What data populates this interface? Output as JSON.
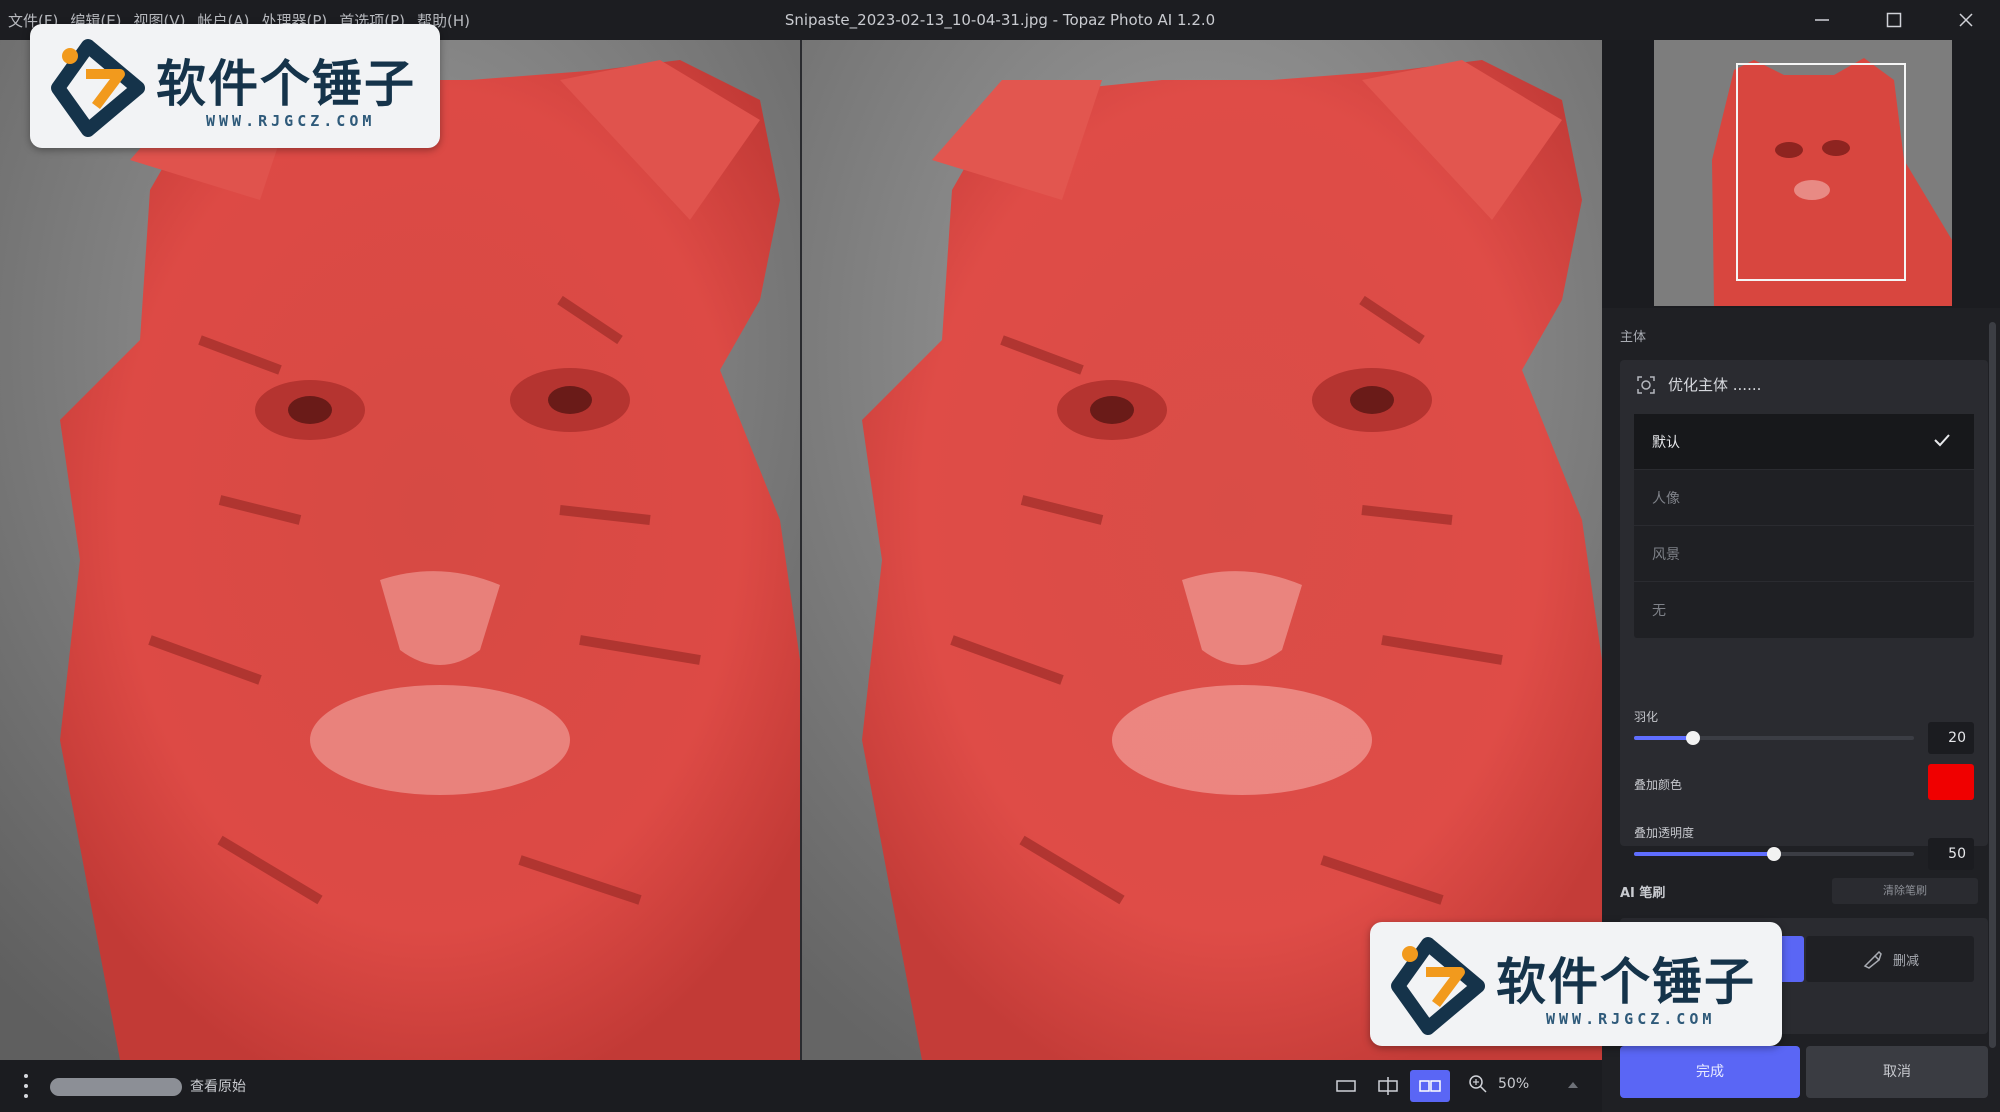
{
  "window": {
    "title": "Snipaste_2023-02-13_10-04-31.jpg - Topaz Photo AI 1.2.0",
    "menu": [
      "文件(F)",
      "编辑(E)",
      "视图(V)",
      "帐户(A)",
      "处理器(P)",
      "首选项(P)",
      "帮助(H)"
    ]
  },
  "watermark": {
    "name": "软件个锤子",
    "url": "WWW.RJGCZ.COM"
  },
  "panel": {
    "subject_section": "主体",
    "refine_label": "优化主体 ......",
    "options": [
      {
        "label": "默认",
        "selected": true
      },
      {
        "label": "人像",
        "selected": false
      },
      {
        "label": "风景",
        "selected": false
      },
      {
        "label": "无",
        "selected": false
      }
    ],
    "feather": {
      "label": "羽化",
      "value": "20",
      "fraction": 0.21
    },
    "overlay_color": {
      "label": "叠加颜色",
      "color": "#f00000"
    },
    "overlay_opacity": {
      "label": "叠加透明度",
      "value": "50",
      "fraction": 0.5
    },
    "ai_brush": {
      "label": "AI 笔刷",
      "clear_label": "清除笔刷",
      "subtract_label": "删减"
    },
    "done_label": "完成",
    "cancel_label": "取消"
  },
  "bottombar": {
    "view_original_label": "查看原始",
    "zoom_level": "50%"
  },
  "colors": {
    "accent": "#5a66f5",
    "mask_overlay": "#e03a3a"
  }
}
